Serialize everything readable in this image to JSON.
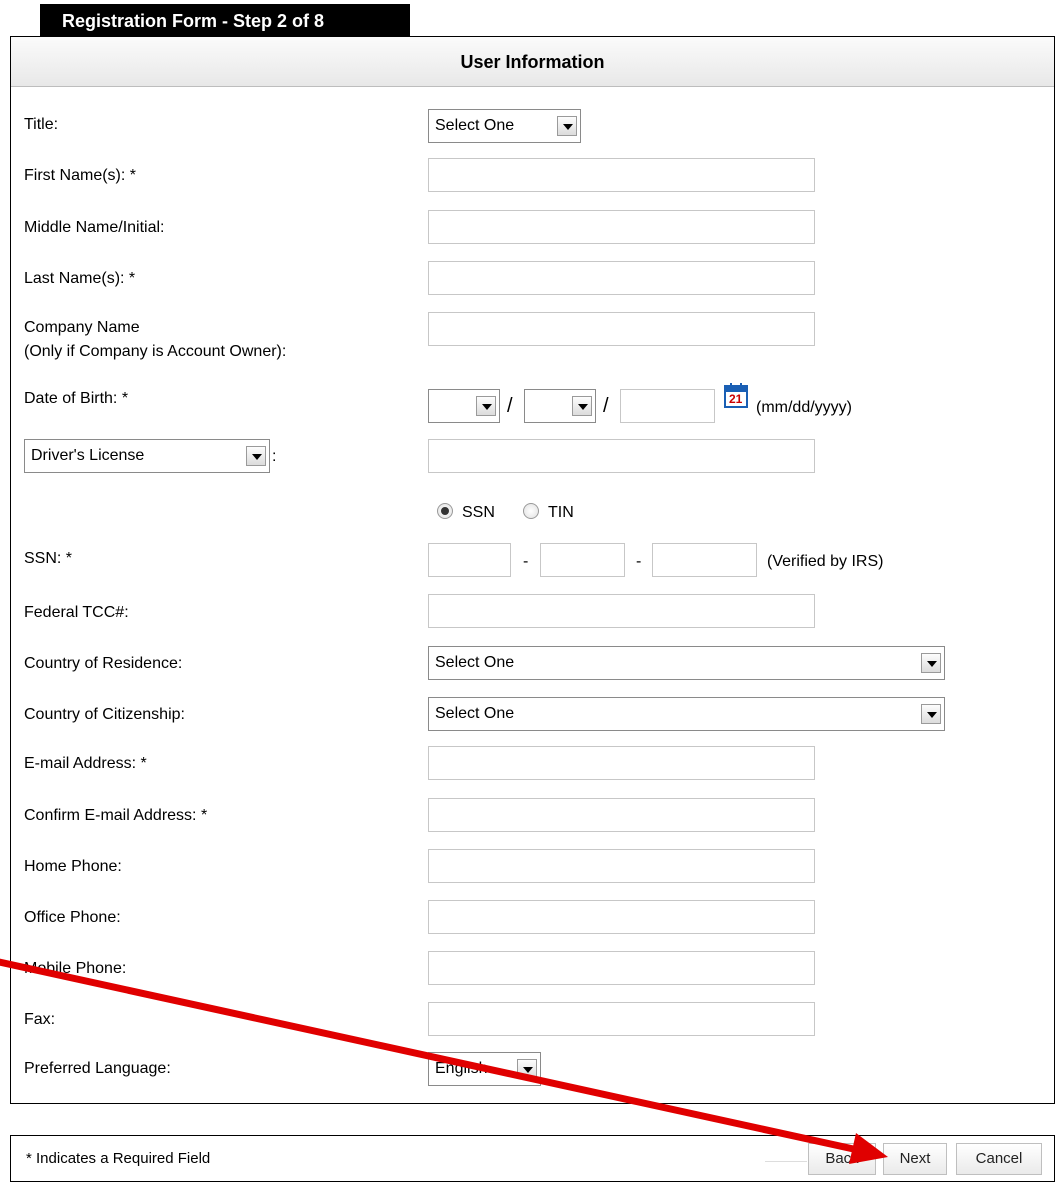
{
  "tab_title": "Registration Form - Step 2 of 8",
  "section_title": "User Information",
  "fields": {
    "title": {
      "label": "Title:",
      "value": "Select One"
    },
    "first_name": {
      "label": "First Name(s): *"
    },
    "middle_name": {
      "label": "Middle Name/Initial:"
    },
    "last_name": {
      "label": "Last Name(s): *"
    },
    "company_name": {
      "label": "Company Name",
      "note": "(Only if Company is Account Owner):"
    },
    "dob": {
      "label": "Date of Birth: *",
      "separator": "/",
      "calendar_day": "21",
      "format": "(mm/dd/yyyy)"
    },
    "id_type": {
      "value": "Driver's License",
      "suffix": ":"
    },
    "tax_type": {
      "option_ssn": "SSN",
      "option_tin": "TIN",
      "selected": "SSN"
    },
    "ssn": {
      "label": "SSN: *",
      "separator": "-",
      "note": "(Verified by IRS)"
    },
    "federal_tcc": {
      "label": "Federal TCC#:"
    },
    "country_residence": {
      "label": "Country of Residence:",
      "value": "Select One"
    },
    "country_citizenship": {
      "label": "Country of Citizenship:",
      "value": "Select One"
    },
    "email": {
      "label": "E-mail Address: *"
    },
    "confirm_email": {
      "label": "Confirm E-mail Address: *"
    },
    "home_phone": {
      "label": "Home Phone:"
    },
    "office_phone": {
      "label": "Office Phone:"
    },
    "mobile_phone": {
      "label": "Mobile Phone:"
    },
    "fax": {
      "label": "Fax:"
    },
    "preferred_language": {
      "label": "Preferred Language:",
      "value": "English"
    }
  },
  "footer": {
    "required_note": "* Indicates a Required Field",
    "back_label": "Back",
    "next_label": "Next",
    "cancel_label": "Cancel"
  },
  "colors": {
    "annotation_arrow": "#e00000",
    "calendar_icon": "#1a5fb4"
  },
  "icons": [
    "calendar-icon",
    "chevron-down-icon",
    "annotation-arrow"
  ]
}
